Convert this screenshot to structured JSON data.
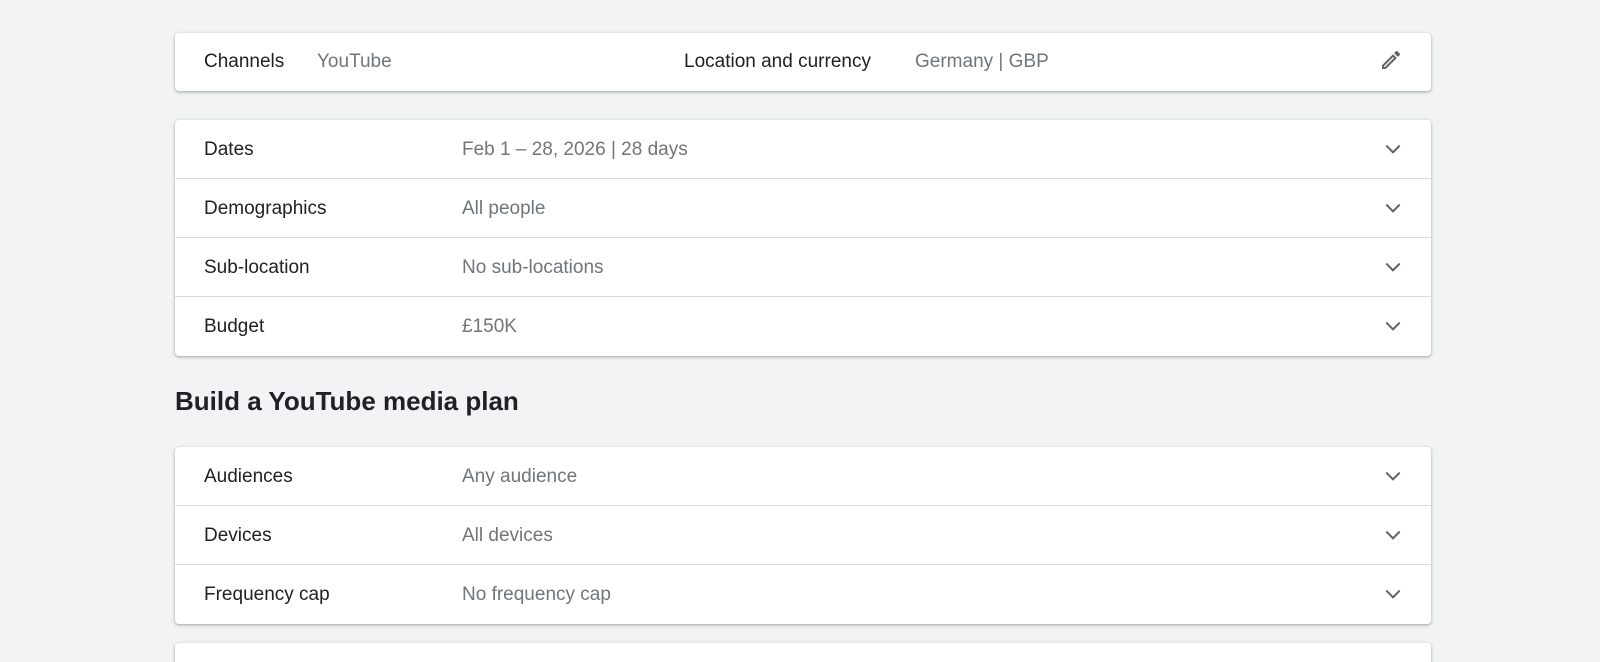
{
  "summary": {
    "channels_label": "Channels",
    "channels_value": "YouTube",
    "location_label": "Location and currency",
    "location_value": "Germany | GBP",
    "edit_icon": "pencil-icon"
  },
  "settings": {
    "rows": [
      {
        "label": "Dates",
        "value": "Feb 1 – 28, 2026 | 28 days"
      },
      {
        "label": "Demographics",
        "value": "All people"
      },
      {
        "label": "Sub-location",
        "value": "No sub-locations"
      },
      {
        "label": "Budget",
        "value": "£150K"
      }
    ]
  },
  "plan_section": {
    "title": "Build a YouTube media plan",
    "rows": [
      {
        "label": "Audiences",
        "value": "Any audience"
      },
      {
        "label": "Devices",
        "value": "All devices"
      },
      {
        "label": "Frequency cap",
        "value": "No frequency cap"
      }
    ]
  },
  "icons": {
    "expand": "chevron-down-icon"
  },
  "colors": {
    "background": "#f1f3f4",
    "card": "#ffffff",
    "label_text": "#202124",
    "value_text": "#70757a",
    "divider": "#dadce0",
    "icon": "#5f6368"
  }
}
